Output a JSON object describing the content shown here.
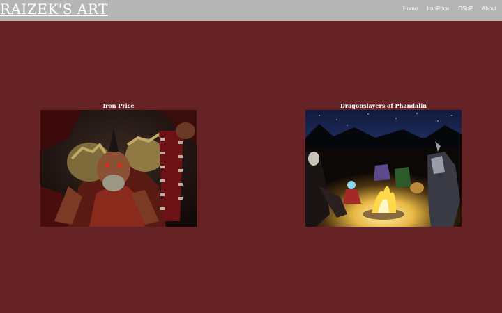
{
  "header": {
    "logo": "RAIZEK'S ART",
    "nav": [
      "Home",
      "IronPrice",
      "DSoP",
      "About"
    ]
  },
  "gallery": [
    {
      "title": "Iron Price"
    },
    {
      "title": "Dragonslayers of Phandalin"
    }
  ],
  "colors": {
    "background": "#652325",
    "header": "#b5b5b5",
    "text": "#ffffff"
  }
}
